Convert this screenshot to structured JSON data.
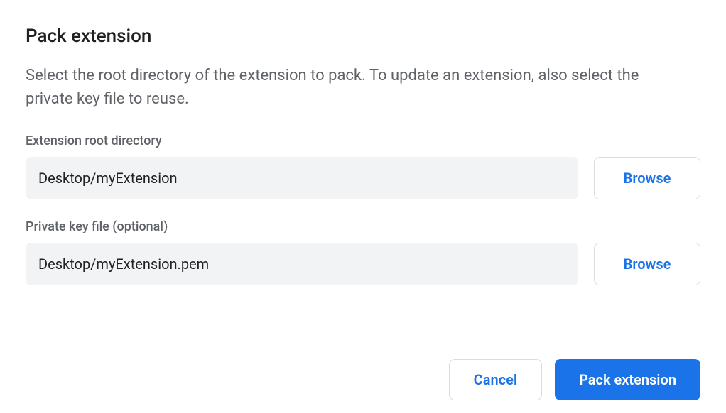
{
  "dialog": {
    "title": "Pack extension",
    "description": "Select the root directory of the extension to pack. To update an extension, also select the private key file to reuse.",
    "fields": {
      "root": {
        "label": "Extension root directory",
        "value": "Desktop/myExtension",
        "browse_label": "Browse"
      },
      "key": {
        "label": "Private key file (optional)",
        "value": "Desktop/myExtension.pem",
        "browse_label": "Browse"
      }
    },
    "footer": {
      "cancel_label": "Cancel",
      "pack_label": "Pack extension"
    }
  }
}
